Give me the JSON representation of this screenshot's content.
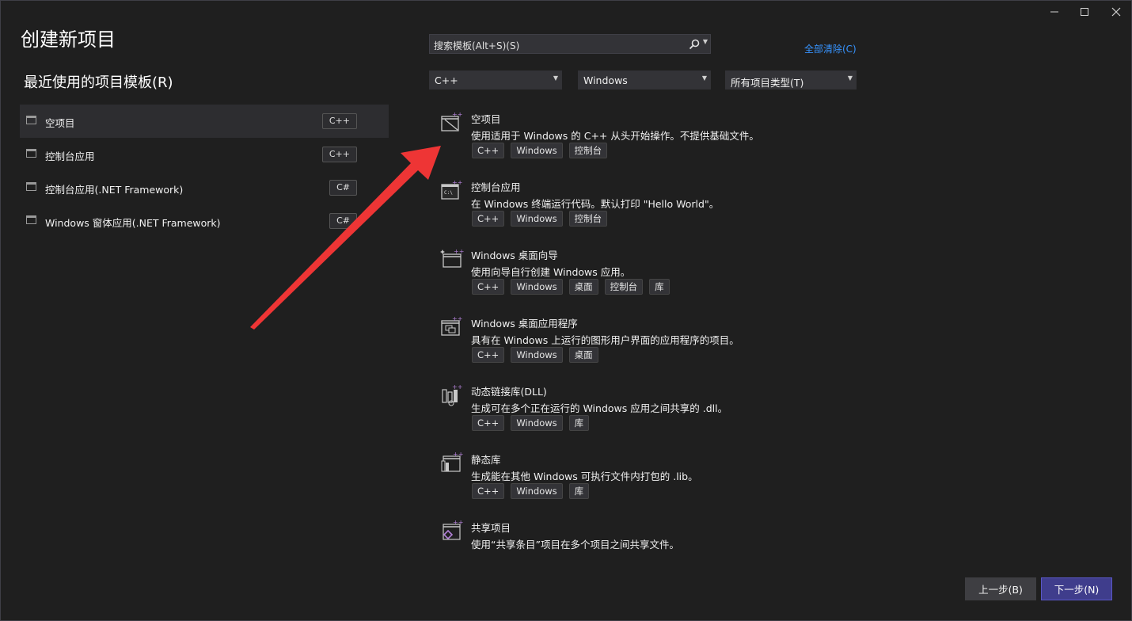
{
  "window": {
    "controls": {
      "minimize": "–",
      "maximize": "□",
      "close": "✕"
    }
  },
  "page_title": "创建新项目",
  "recent": {
    "title": "最近使用的项目模板(R)",
    "items": [
      {
        "label": "空项目",
        "badge": "C++",
        "selected": true
      },
      {
        "label": "控制台应用",
        "badge": "C++",
        "selected": false
      },
      {
        "label": "控制台应用(.NET Framework)",
        "badge": "C#",
        "selected": false
      },
      {
        "label": "Windows 窗体应用(.NET Framework)",
        "badge": "C#",
        "selected": false
      }
    ]
  },
  "search": {
    "placeholder": "搜索模板(Alt+S)(S)",
    "icon": "search-icon"
  },
  "clear_all": "全部清除(C)",
  "filters": {
    "language": "C++",
    "platform": "Windows",
    "project_type": "所有项目类型(T)"
  },
  "templates": [
    {
      "name": "空项目",
      "desc": "使用适用于 Windows 的 C++ 从头开始操作。不提供基础文件。",
      "tags": [
        "C++",
        "Windows",
        "控制台"
      ],
      "icon": "empty-project-icon"
    },
    {
      "name": "控制台应用",
      "desc": "在 Windows 终端运行代码。默认打印 \"Hello World\"。",
      "tags": [
        "C++",
        "Windows",
        "控制台"
      ],
      "icon": "console-app-icon"
    },
    {
      "name": "Windows 桌面向导",
      "desc": "使用向导自行创建 Windows 应用。",
      "tags": [
        "C++",
        "Windows",
        "桌面",
        "控制台",
        "库"
      ],
      "icon": "desktop-wizard-icon"
    },
    {
      "name": "Windows 桌面应用程序",
      "desc": "具有在 Windows 上运行的图形用户界面的应用程序的项目。",
      "tags": [
        "C++",
        "Windows",
        "桌面"
      ],
      "icon": "desktop-app-icon"
    },
    {
      "name": "动态链接库(DLL)",
      "desc": "生成可在多个正在运行的 Windows 应用之间共享的 .dll。",
      "tags": [
        "C++",
        "Windows",
        "库"
      ],
      "icon": "dll-icon"
    },
    {
      "name": "静态库",
      "desc": "生成能在其他 Windows 可执行文件内打包的 .lib。",
      "tags": [
        "C++",
        "Windows",
        "库"
      ],
      "icon": "static-lib-icon"
    },
    {
      "name": "共享项目",
      "desc": "使用“共享条目”项目在多个项目之间共享文件。",
      "tags": [],
      "icon": "shared-project-icon"
    }
  ],
  "buttons": {
    "back": "上一步(B)",
    "next": "下一步(N)"
  },
  "colors": {
    "background": "#1f1f1f",
    "accent": "#3f3d8c",
    "link": "#3794ff",
    "annotation_arrow": "#ee3535",
    "cpp_plus": "#b180d7"
  }
}
